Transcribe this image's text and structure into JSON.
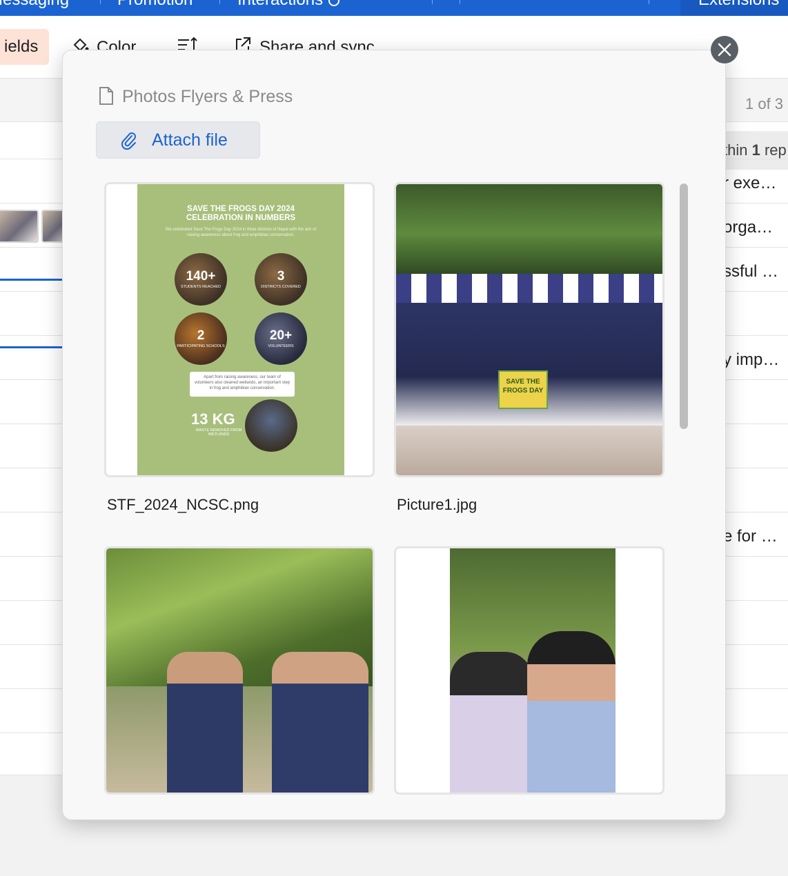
{
  "nav": {
    "tabs": [
      "Messaging",
      "Promotion",
      "Interactions",
      "Extensions"
    ]
  },
  "toolbar": {
    "fields_label": "ields",
    "color_label": "Color",
    "share_label": "Share and sync",
    "sort_icon": "sort-icon"
  },
  "grid": {
    "pager": "1 of 3",
    "within_prefix": "thin ",
    "within_count": "1",
    "within_suffix": " rep",
    "cells": [
      "r exe…",
      "orga…",
      "ssful …",
      "y imp…",
      "e for …"
    ]
  },
  "modal": {
    "title": "Photos Flyers & Press",
    "attach_label": "Attach file",
    "files": [
      {
        "name": "STF_2024_NCSC.png"
      },
      {
        "name": "Picture1.jpg"
      }
    ],
    "poster": {
      "title_line1": "SAVE THE FROGS DAY 2024",
      "title_line2": "CELEBRATION  IN NUMBERS",
      "subtitle": "We celebrated Save The Frogs Day 2024 in three districts of Nepal with the aim of raising awareness about frog and amphibian conservation.",
      "stats": [
        {
          "num": "140+",
          "label": "STUDENTS REACHED"
        },
        {
          "num": "3",
          "label": "DISTRICTS COVERED"
        },
        {
          "num": "2",
          "label": "PARTICIPATING SCHOOLS"
        },
        {
          "num": "20+",
          "label": "VOLUNTEERS"
        }
      ],
      "note": "Apart from raising awareness, our team of volunteers also cleaned wetlands, an important step in frog and amphibian conservation.",
      "kg": "13 KG",
      "kg_label": "WASTE REMOVED FROM WETLANDS"
    },
    "banner_text": "SAVE THE FROGS DAY"
  },
  "colors": {
    "accent": "#1b63d1",
    "fields_bg": "#fde2d7",
    "poster_green": "#a8bf7c"
  }
}
